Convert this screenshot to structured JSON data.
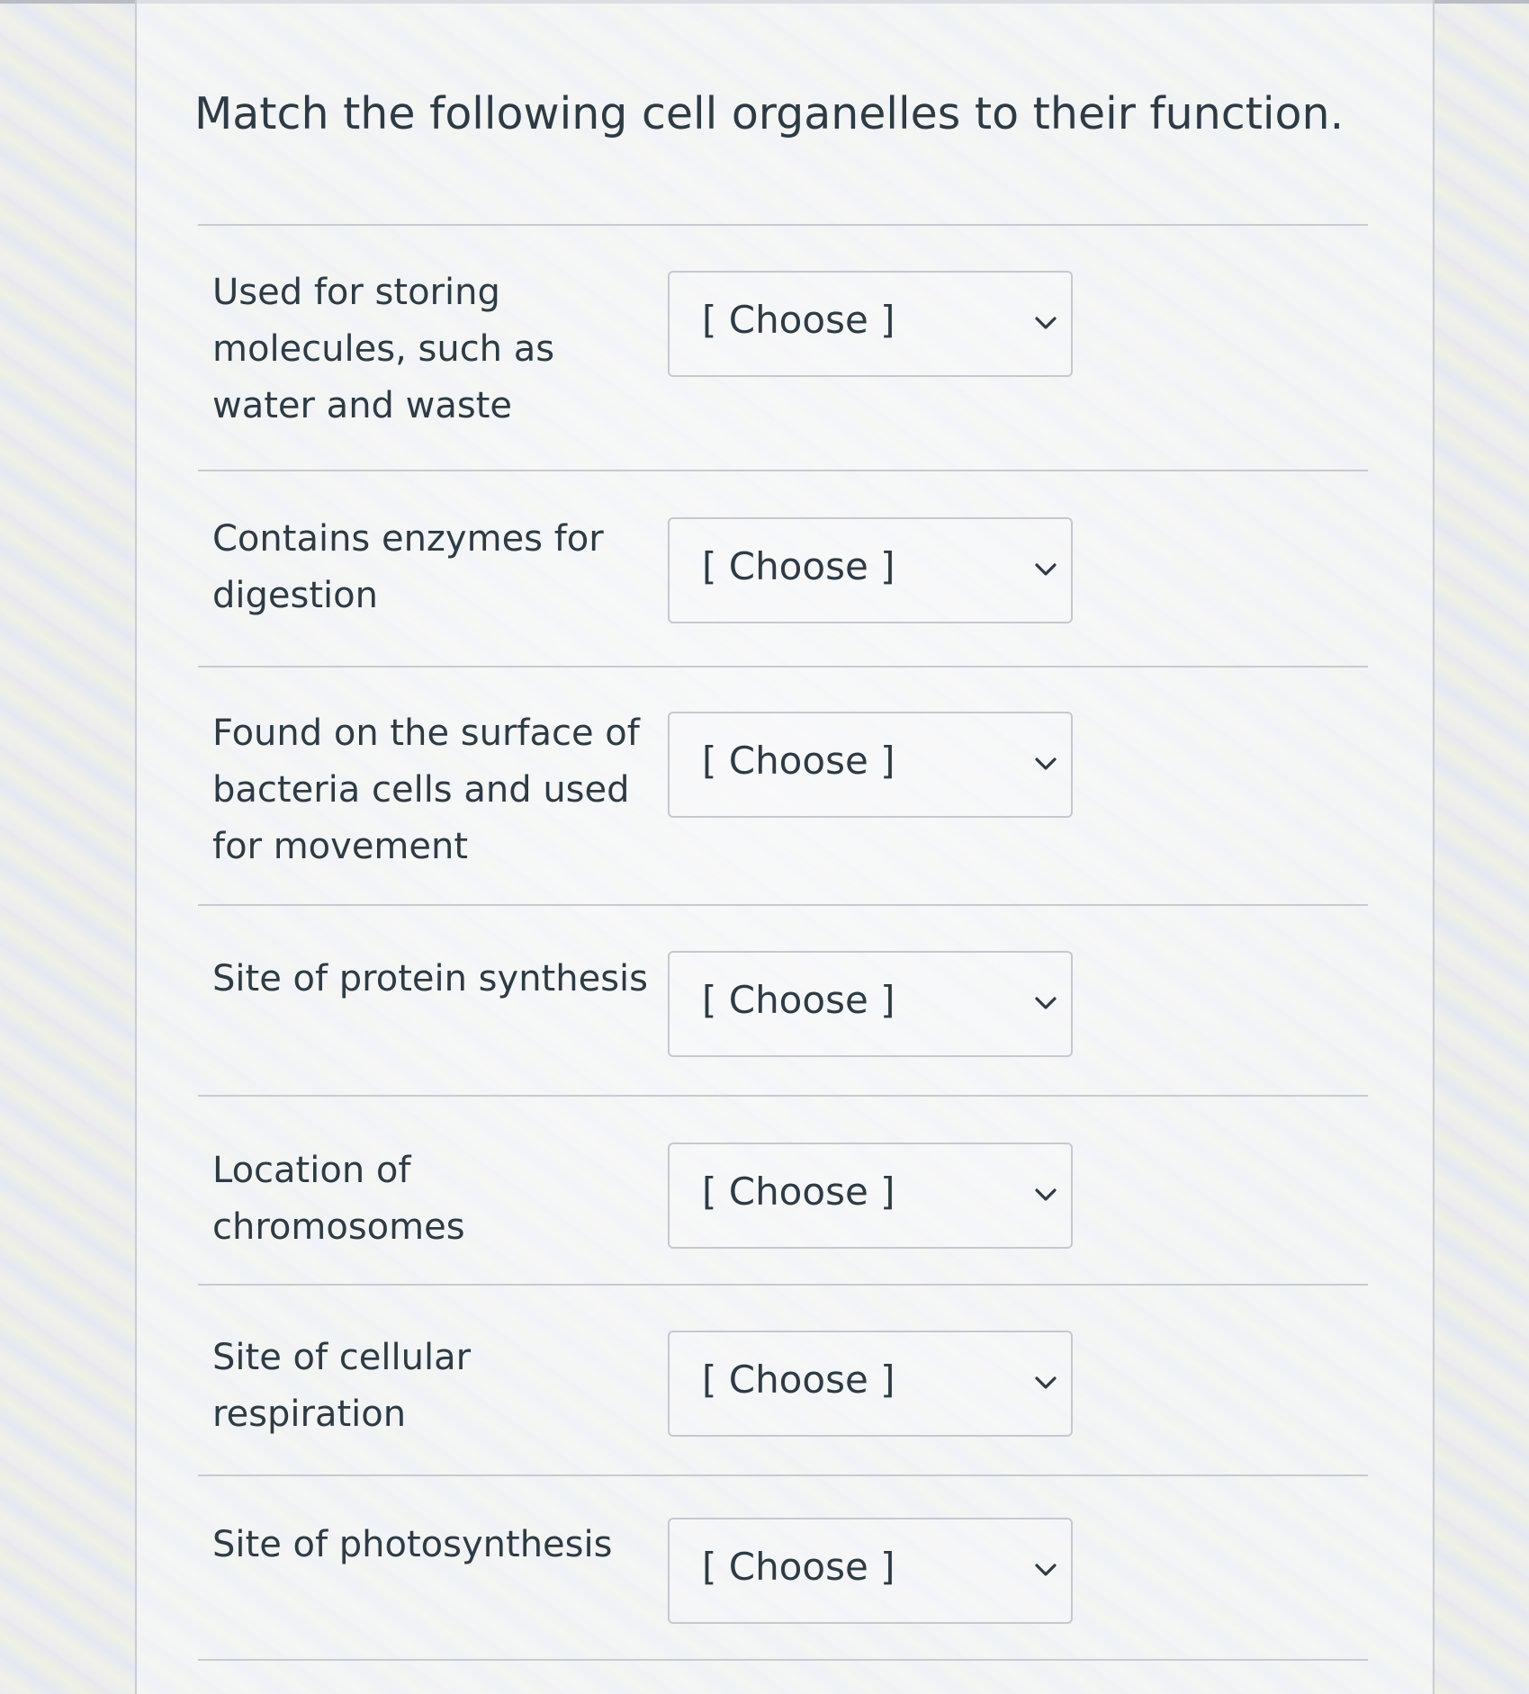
{
  "question": {
    "title": "Match the following cell organelles to their function."
  },
  "rows": [
    {
      "prompt": "Used for storing molecules, such as water and waste",
      "selected": "[ Choose ]"
    },
    {
      "prompt": "Contains enzymes for digestion",
      "selected": "[ Choose ]"
    },
    {
      "prompt": "Found on the surface of bacteria cells and used for movement",
      "selected": "[ Choose ]"
    },
    {
      "prompt": "Site of protein synthesis",
      "selected": "[ Choose ]"
    },
    {
      "prompt": "Location of chromosomes",
      "selected": "[ Choose ]"
    },
    {
      "prompt": "Site of cellular respiration",
      "selected": "[ Choose ]"
    },
    {
      "prompt": "Site of photosynthesis",
      "selected": "[ Choose ]"
    }
  ],
  "icons": {
    "dropdown": "chevron-down-icon"
  },
  "colors": {
    "text": "#2d3b45",
    "border": "#c5c8cf"
  }
}
